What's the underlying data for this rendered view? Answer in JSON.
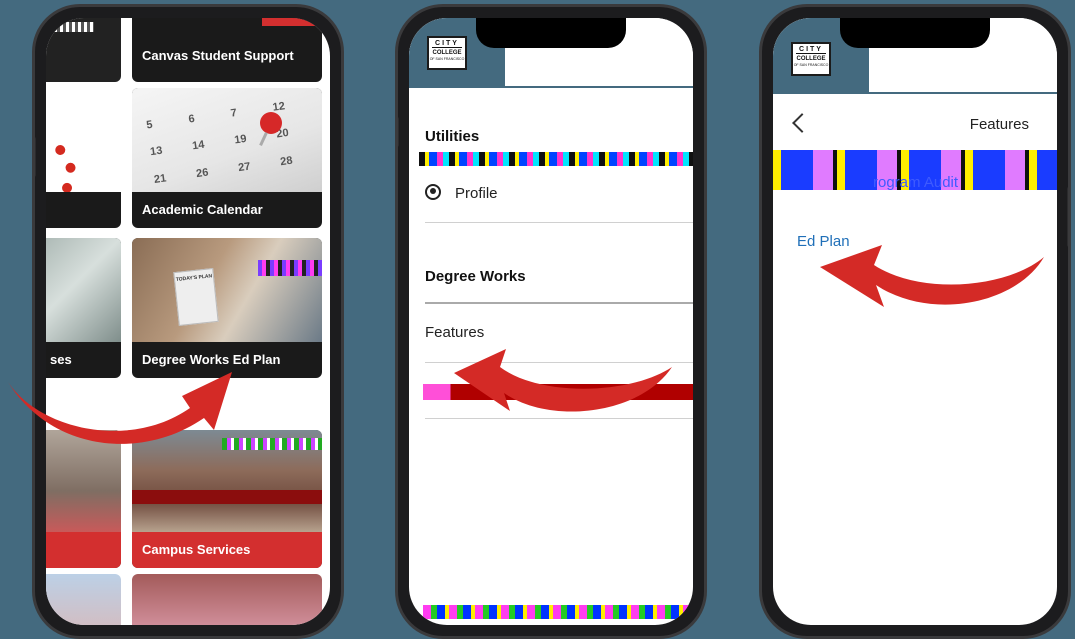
{
  "phone1": {
    "tiles": {
      "canvas_support": "Canvas Student Support",
      "academic_calendar": "Academic Calendar",
      "courses_partial": "ses",
      "degree_works_ed_plan": "Degree Works Ed Plan",
      "campus_services": "Campus Services"
    },
    "calendar_numbers": [
      "5",
      "6",
      "7",
      "12",
      "13",
      "14",
      "19",
      "20",
      "21",
      "26",
      "27",
      "28"
    ],
    "notepad_text": "TODAY'S PLAN"
  },
  "phone2": {
    "logo": {
      "line1": "CITY",
      "line2": "COLLEGE",
      "line3": "OF SAN FRANCISCO"
    },
    "sections": [
      {
        "title": "Utilities",
        "items": [
          "Profile"
        ]
      },
      {
        "title": "Degree Works",
        "items": [
          "Features"
        ]
      }
    ]
  },
  "phone3": {
    "logo": {
      "line1": "CITY",
      "line2": "COLLEGE",
      "line3": "OF SAN FRANCISCO"
    },
    "page_title": "Features",
    "links": [
      "Program Audit",
      "Ed Plan"
    ],
    "partial_link": "rogram Audit"
  },
  "colors": {
    "background": "#446a7f",
    "arrow_red": "#d42a26",
    "link_blue": "#1f6fb8",
    "tile_red": "#d32f2f"
  }
}
